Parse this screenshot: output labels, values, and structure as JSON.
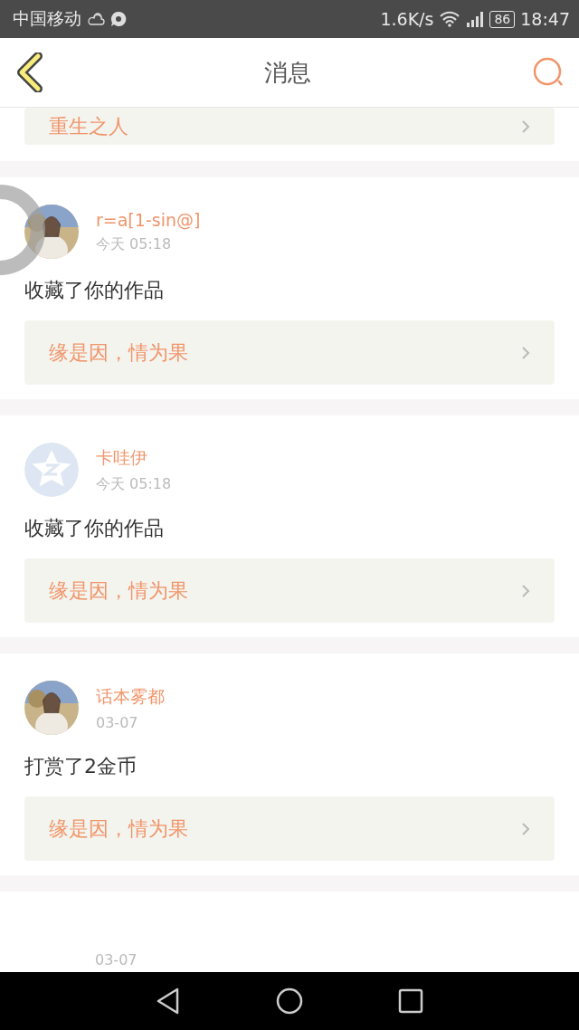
{
  "status_bar": {
    "carrier": "中国移动",
    "speed": "1.6K/s",
    "battery": "86",
    "time": "18:47"
  },
  "header": {
    "title": "消息"
  },
  "top_link": {
    "text": "重生之人"
  },
  "messages": [
    {
      "name": "r=a[1-sin@]",
      "time": "今天 05:18",
      "action": "收藏了你的作品",
      "link": "缘是因，情为果"
    },
    {
      "avatar": {
        "kind": "default"
      },
      "name": "卡哇伊",
      "time": "今天 05:18",
      "action": "收藏了你的作品",
      "link": "缘是因，情为果"
    },
    {
      "name": "话本雾都",
      "time": "03-07",
      "action": "打赏了2金币",
      "link": "缘是因，情为果"
    }
  ],
  "partial_message": {
    "time": "03-07"
  }
}
